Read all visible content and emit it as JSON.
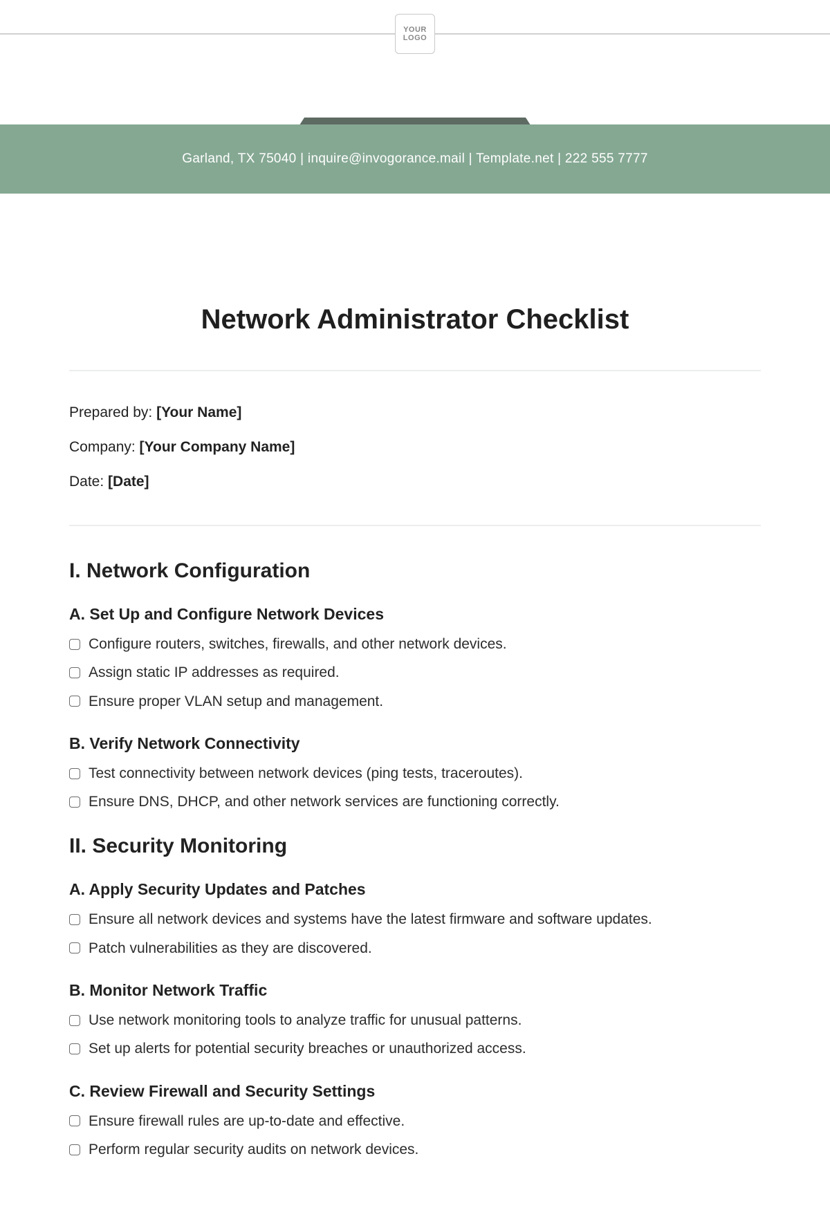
{
  "logo": {
    "line1": "YOUR",
    "line2": "LOGO"
  },
  "band": "Garland, TX 75040 | inquire@invogorance.mail | Template.net | 222 555 7777",
  "title": "Network Administrator Checklist",
  "meta": {
    "prepared_label": "Prepared by: ",
    "prepared_value": "[Your Name]",
    "company_label": "Company: ",
    "company_value": "[Your Company Name]",
    "date_label": "Date: ",
    "date_value": "[Date]"
  },
  "sections": [
    {
      "heading": "I. Network Configuration",
      "groups": [
        {
          "sub": "A. Set Up and Configure Network Devices",
          "items": [
            "Configure routers, switches, firewalls, and other network devices.",
            "Assign static IP addresses as required.",
            "Ensure proper VLAN setup and management."
          ]
        },
        {
          "sub": "B. Verify Network Connectivity",
          "items": [
            "Test connectivity between network devices (ping tests, traceroutes).",
            "Ensure DNS, DHCP, and other network services are functioning correctly."
          ]
        }
      ]
    },
    {
      "heading": "II. Security Monitoring",
      "groups": [
        {
          "sub": "A. Apply Security Updates and Patches",
          "items": [
            "Ensure all network devices and systems have the latest firmware and software updates.",
            "Patch vulnerabilities as they are discovered."
          ]
        },
        {
          "sub": "B. Monitor Network Traffic",
          "items": [
            "Use network monitoring tools to analyze traffic for unusual patterns.",
            "Set up alerts for potential security breaches or unauthorized access."
          ]
        },
        {
          "sub": "C. Review Firewall and Security Settings",
          "items": [
            "Ensure firewall rules are up-to-date and effective.",
            "Perform regular security audits on network devices."
          ]
        }
      ]
    }
  ]
}
